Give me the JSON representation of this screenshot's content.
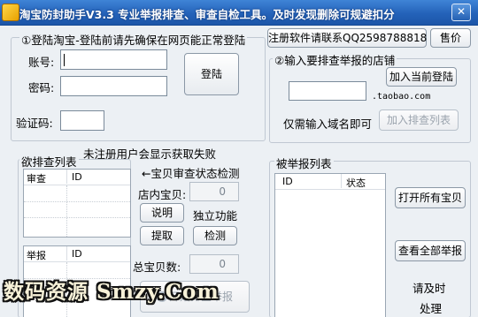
{
  "window": {
    "title": "淘宝防封助手V3.3    专业举报排查、审查自检工具。及时发现删除可规避扣分",
    "close_glyph": "✕"
  },
  "top_buttons": {
    "register": "注册软件请联系QQ2598788818",
    "price": "售价"
  },
  "login": {
    "heading": "①登陆淘宝-登陆前请先确保在网页能正常登陆",
    "account_label": "账号:",
    "password_label": "密码:",
    "captcha_label": "验证码:",
    "login_button": "登陆"
  },
  "shop": {
    "heading": "②输入要排查举报的店铺",
    "domain_suffix": ".taobao.com",
    "hint": "仅需输入域名即可",
    "add_current": "加入当前登陆",
    "add_list": "加入排查列表"
  },
  "notice": "未注册用户会显示获取失败",
  "check_list": {
    "title": "欲排查列表",
    "audit_columns": [
      "审查",
      "ID"
    ],
    "report_columns": [
      "举报",
      "ID"
    ]
  },
  "status_check": {
    "title": "←宝贝审查状态检测",
    "items_label": "店内宝贝:",
    "items_value": "0",
    "total_label": "总宝贝数:",
    "total_value": "0",
    "explain": "说明",
    "standalone": "独立功能",
    "extract": "提取",
    "detect": "检测",
    "start": "开始排查举报"
  },
  "reported": {
    "title": "被举报列表",
    "columns": [
      "ID",
      "状态"
    ],
    "open_all": "打开所有宝贝",
    "view_all": "查看全部举报",
    "handle_line1": "请及时",
    "handle_line2": "处理"
  },
  "watermark": "数码资源 Smzy.Com"
}
